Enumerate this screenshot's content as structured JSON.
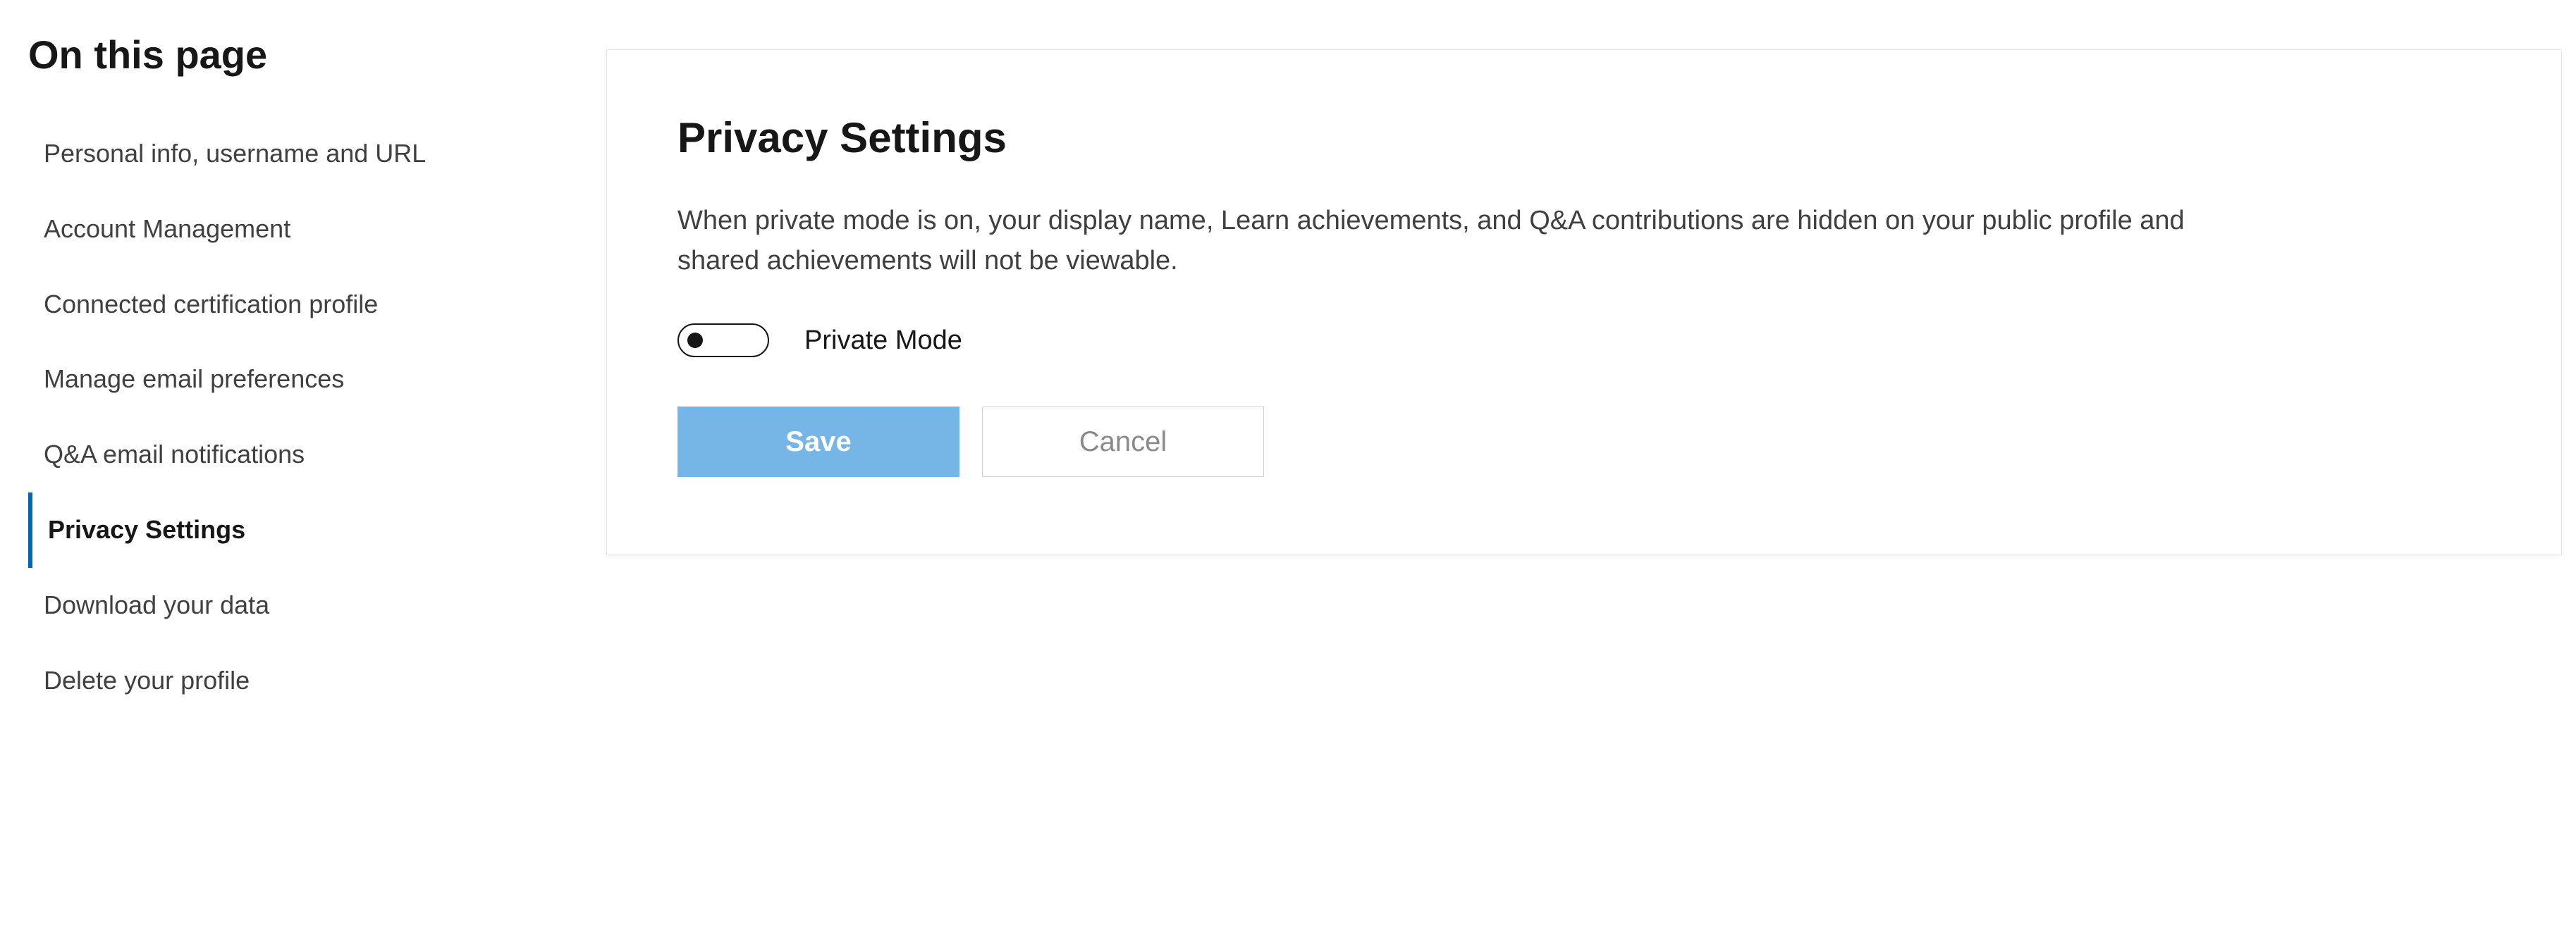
{
  "sidebar": {
    "heading": "On this page",
    "items": [
      {
        "label": "Personal info, username and URL",
        "active": false
      },
      {
        "label": "Account Management",
        "active": false
      },
      {
        "label": "Connected certification profile",
        "active": false
      },
      {
        "label": "Manage email preferences",
        "active": false
      },
      {
        "label": "Q&A email notifications",
        "active": false
      },
      {
        "label": "Privacy Settings",
        "active": true
      },
      {
        "label": "Download your data",
        "active": false
      },
      {
        "label": "Delete your profile",
        "active": false
      }
    ]
  },
  "panel": {
    "title": "Privacy Settings",
    "description": "When private mode is on, your display name, Learn achievements, and Q&A contributions are hidden on your public profile and shared achievements will not be viewable.",
    "toggle": {
      "label": "Private Mode",
      "checked": false
    },
    "buttons": {
      "save": "Save",
      "cancel": "Cancel"
    }
  }
}
